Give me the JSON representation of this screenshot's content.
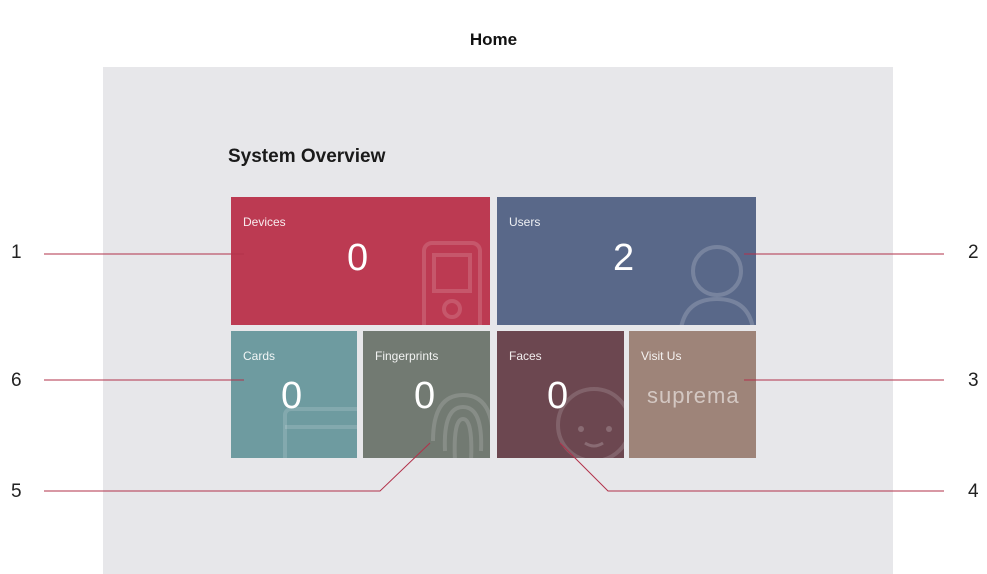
{
  "header": {
    "title": "Home"
  },
  "overview": {
    "title": "System Overview",
    "tiles": {
      "devices": {
        "label": "Devices",
        "count": "0",
        "color": "#bc3a52"
      },
      "users": {
        "label": "Users",
        "count": "2",
        "color": "#596889"
      },
      "cards": {
        "label": "Cards",
        "count": "0",
        "color": "#6e9ba0"
      },
      "fingerprints": {
        "label": "Fingerprints",
        "count": "0",
        "color": "#727a72"
      },
      "faces": {
        "label": "Faces",
        "count": "0",
        "color": "#6c4750"
      },
      "visit": {
        "label": "Visit Us",
        "brand": "suprema",
        "color": "#9e8479"
      }
    }
  },
  "callouts": [
    "1",
    "2",
    "3",
    "4",
    "5",
    "6"
  ]
}
